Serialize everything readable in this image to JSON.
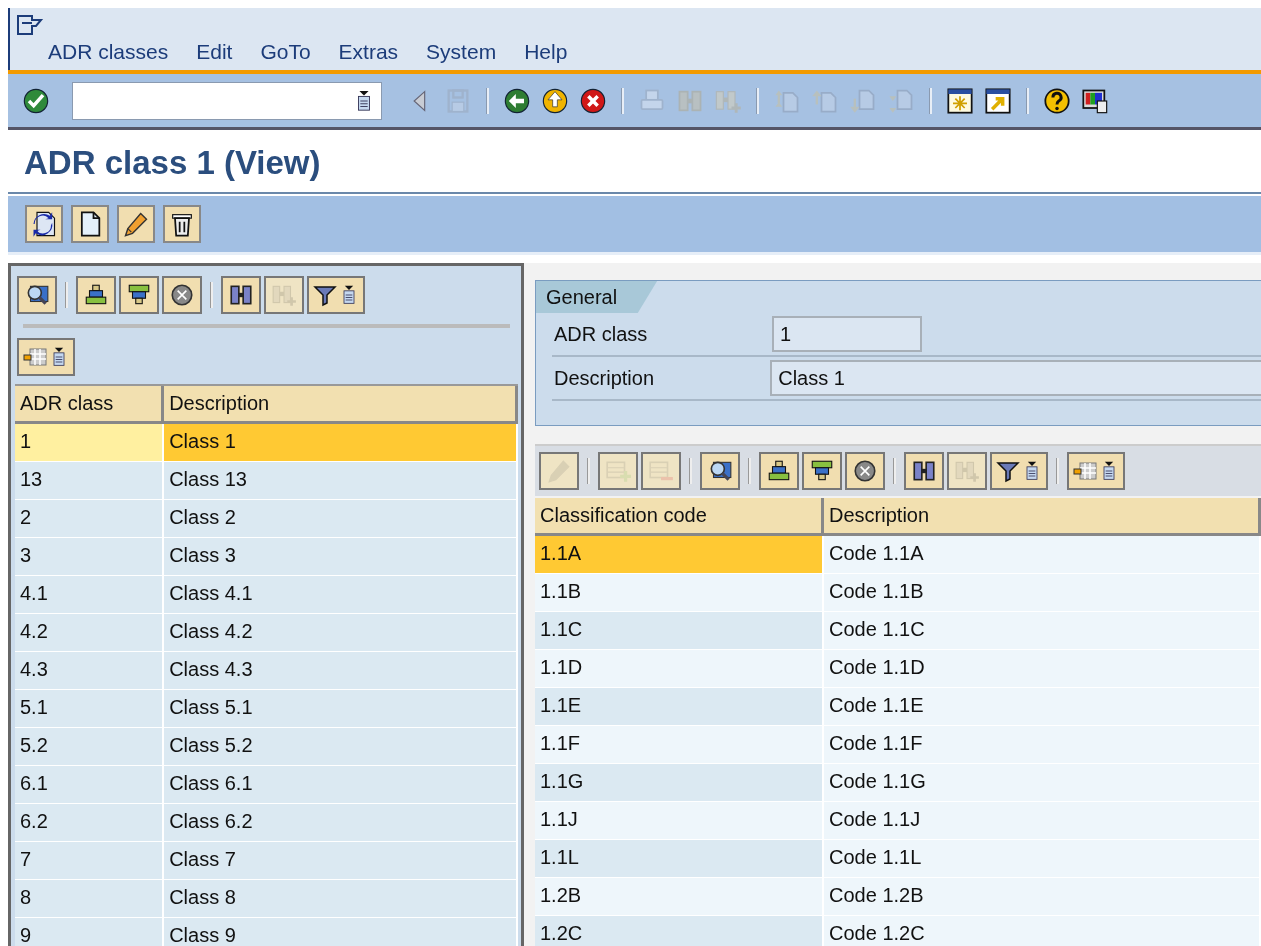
{
  "menu_bar": {
    "items": [
      "ADR classes",
      "Edit",
      "GoTo",
      "Extras",
      "System",
      "Help"
    ]
  },
  "standard_toolbar": [
    {
      "kind": "enter",
      "disabled": false
    },
    {
      "kind": "command-field"
    },
    {
      "kind": "triangle",
      "disabled": false
    },
    {
      "kind": "save",
      "disabled": true
    },
    {
      "kind": "separator"
    },
    {
      "kind": "back",
      "disabled": false
    },
    {
      "kind": "exit",
      "disabled": false
    },
    {
      "kind": "cancel",
      "disabled": false
    },
    {
      "kind": "separator"
    },
    {
      "kind": "print",
      "disabled": true
    },
    {
      "kind": "find",
      "disabled": true
    },
    {
      "kind": "find-next",
      "disabled": true
    },
    {
      "kind": "separator"
    },
    {
      "kind": "first-page",
      "disabled": true
    },
    {
      "kind": "previous-page",
      "disabled": true
    },
    {
      "kind": "next-page",
      "disabled": true
    },
    {
      "kind": "last-page",
      "disabled": true
    },
    {
      "kind": "separator"
    },
    {
      "kind": "new-session",
      "disabled": false
    },
    {
      "kind": "shortcut",
      "disabled": false
    },
    {
      "kind": "separator"
    },
    {
      "kind": "help",
      "disabled": false
    },
    {
      "kind": "layout",
      "disabled": false
    }
  ],
  "title": "ADR class 1 (View)",
  "application_toolbar": [
    {
      "kind": "refresh",
      "disabled": false
    },
    {
      "kind": "new-document",
      "disabled": false
    },
    {
      "kind": "change",
      "disabled": false
    },
    {
      "kind": "delete",
      "disabled": false
    }
  ],
  "list_panel": {
    "toolbar": [
      {
        "kind": "details",
        "disabled": false
      },
      {
        "kind": "separator"
      },
      {
        "kind": "sort-ascending",
        "disabled": false
      },
      {
        "kind": "sort-descending",
        "disabled": false
      },
      {
        "kind": "delete-filter",
        "disabled": false
      },
      {
        "kind": "separator"
      },
      {
        "kind": "find",
        "disabled": false
      },
      {
        "kind": "find-next",
        "disabled": true
      },
      {
        "kind": "filter-menu",
        "disabled": false
      }
    ],
    "toolbar_2": [
      {
        "kind": "layout-menu",
        "disabled": false
      }
    ],
    "table": {
      "columns": [
        "ADR class",
        "Description"
      ],
      "rows": [
        {
          "cells": [
            "1",
            "Class 1"
          ],
          "selected": true
        },
        {
          "cells": [
            "13",
            "Class 13"
          ],
          "selected": false
        },
        {
          "cells": [
            "2",
            "Class 2"
          ],
          "selected": false
        },
        {
          "cells": [
            "3",
            "Class 3"
          ],
          "selected": false
        },
        {
          "cells": [
            "4.1",
            "Class 4.1"
          ],
          "selected": false
        },
        {
          "cells": [
            "4.2",
            "Class 4.2"
          ],
          "selected": false
        },
        {
          "cells": [
            "4.3",
            "Class 4.3"
          ],
          "selected": false
        },
        {
          "cells": [
            "5.1",
            "Class 5.1"
          ],
          "selected": false
        },
        {
          "cells": [
            "5.2",
            "Class 5.2"
          ],
          "selected": false
        },
        {
          "cells": [
            "6.1",
            "Class 6.1"
          ],
          "selected": false
        },
        {
          "cells": [
            "6.2",
            "Class 6.2"
          ],
          "selected": false
        },
        {
          "cells": [
            "7",
            "Class 7"
          ],
          "selected": false
        },
        {
          "cells": [
            "8",
            "Class 8"
          ],
          "selected": false
        },
        {
          "cells": [
            "9",
            "Class 9"
          ],
          "selected": false
        }
      ]
    }
  },
  "detail_panel": {
    "tab": "General",
    "fields": [
      {
        "label": "ADR class",
        "value": "1"
      },
      {
        "label": "Description",
        "value": "Class 1"
      }
    ],
    "toolbar": [
      {
        "kind": "change",
        "disabled": true
      },
      {
        "kind": "separator"
      },
      {
        "kind": "insert-row",
        "disabled": true
      },
      {
        "kind": "delete-row",
        "disabled": true
      },
      {
        "kind": "separator"
      },
      {
        "kind": "details",
        "disabled": false
      },
      {
        "kind": "separator"
      },
      {
        "kind": "sort-ascending",
        "disabled": false
      },
      {
        "kind": "sort-descending",
        "disabled": false
      },
      {
        "kind": "delete-filter",
        "disabled": false
      },
      {
        "kind": "separator"
      },
      {
        "kind": "find",
        "disabled": false
      },
      {
        "kind": "find-next",
        "disabled": true
      },
      {
        "kind": "filter-menu",
        "disabled": false
      },
      {
        "kind": "separator"
      },
      {
        "kind": "layout-menu",
        "disabled": false
      }
    ],
    "table": {
      "columns": [
        "Classification code",
        "Description"
      ],
      "rows": [
        {
          "cells": [
            "1.1A",
            "Code 1.1A"
          ],
          "selected": true
        },
        {
          "cells": [
            "1.1B",
            "Code 1.1B"
          ],
          "selected": false
        },
        {
          "cells": [
            "1.1C",
            "Code 1.1C"
          ],
          "selected": false
        },
        {
          "cells": [
            "1.1D",
            "Code 1.1D"
          ],
          "selected": false
        },
        {
          "cells": [
            "1.1E",
            "Code 1.1E"
          ],
          "selected": false
        },
        {
          "cells": [
            "1.1F",
            "Code 1.1F"
          ],
          "selected": false
        },
        {
          "cells": [
            "1.1G",
            "Code 1.1G"
          ],
          "selected": false
        },
        {
          "cells": [
            "1.1J",
            "Code 1.1J"
          ],
          "selected": false
        },
        {
          "cells": [
            "1.1L",
            "Code 1.1L"
          ],
          "selected": false
        },
        {
          "cells": [
            "1.2B",
            "Code 1.2B"
          ],
          "selected": false
        },
        {
          "cells": [
            "1.2C",
            "Code 1.2C"
          ],
          "selected": false
        }
      ]
    }
  }
}
